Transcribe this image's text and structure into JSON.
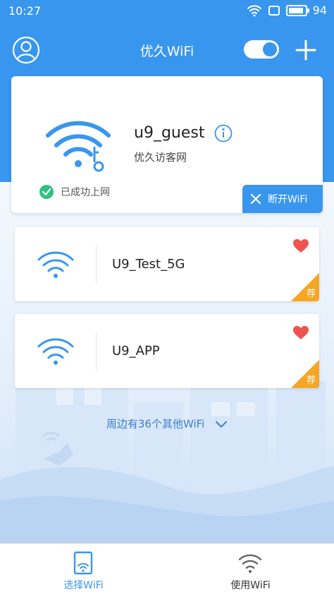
{
  "status_bar": {
    "time": "10:27",
    "battery": "94"
  },
  "header": {
    "title": "优久WiFi"
  },
  "connected": {
    "ssid": "u9_guest",
    "subtitle": "优久访客网",
    "status": "已成功上网",
    "disconnect_label": "断开WiFi"
  },
  "networks": [
    {
      "ssid": "U9_Test_5G",
      "badge": "荐"
    },
    {
      "ssid": "U9_APP",
      "badge": "荐"
    }
  ],
  "more_networks": "周边有36个其他WiFi",
  "bottom_nav": [
    {
      "label": "选择WiFi",
      "active": true
    },
    {
      "label": "使用WiFi",
      "active": false
    }
  ],
  "colors": {
    "primary": "#3996ef",
    "badge": "#f5a623",
    "heart": "#ef5350",
    "success": "#2ec27e"
  }
}
